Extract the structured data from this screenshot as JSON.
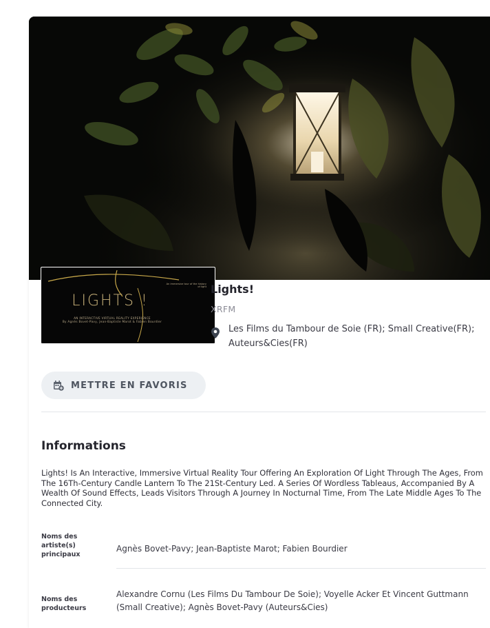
{
  "project": {
    "title": "Lights!",
    "company": "XRFM",
    "location": "Les Films du Tambour de Soie (FR); Small Creative(FR); Auteurs&Cies(FR)"
  },
  "poster": {
    "title": "LIGHTS !",
    "subtitle": "AN INTERACTIVE VIRTUAL REALITY EXPERIENCE",
    "credits": "By Agnès Bovet-Pavy, Jean-Baptiste Marot & Fabien Bourdier",
    "tagline": "An immersive tour of the history of light"
  },
  "actions": {
    "favorite_label": "METTRE EN FAVORIS"
  },
  "informations": {
    "heading": "Informations",
    "description": "Lights! Is An Interactive, Immersive Virtual Reality Tour Offering An Exploration Of Light Through The Ages, From The 16Th-Century Candle Lantern To The 21St-Century Led. A Series Of Wordless Tableaus, Accompanied By A Wealth Of Sound Effects, Leads Visitors Through A Journey In Nocturnal Time, From The Late Middle Ages To The Connected City.",
    "rows": [
      {
        "label": "Noms des artiste(s) principaux",
        "value": "Agnès Bovet-Pavy; Jean-Baptiste Marot; Fabien Bourdier"
      },
      {
        "label": "Noms des producteurs",
        "value": "Alexandre Cornu (Les Films Du Tambour De Soie); Voyelle Acker Et Vincent Guttmann (Small Creative); Agnès Bovet-Pavy (Auteurs&Cies)"
      }
    ]
  },
  "icons": {
    "location": "map-pin-icon",
    "favorite": "calendar-add-icon"
  },
  "colors": {
    "accent": "#4e5560",
    "button_bg": "#edf0f3",
    "muted_text": "#8c8c96"
  }
}
